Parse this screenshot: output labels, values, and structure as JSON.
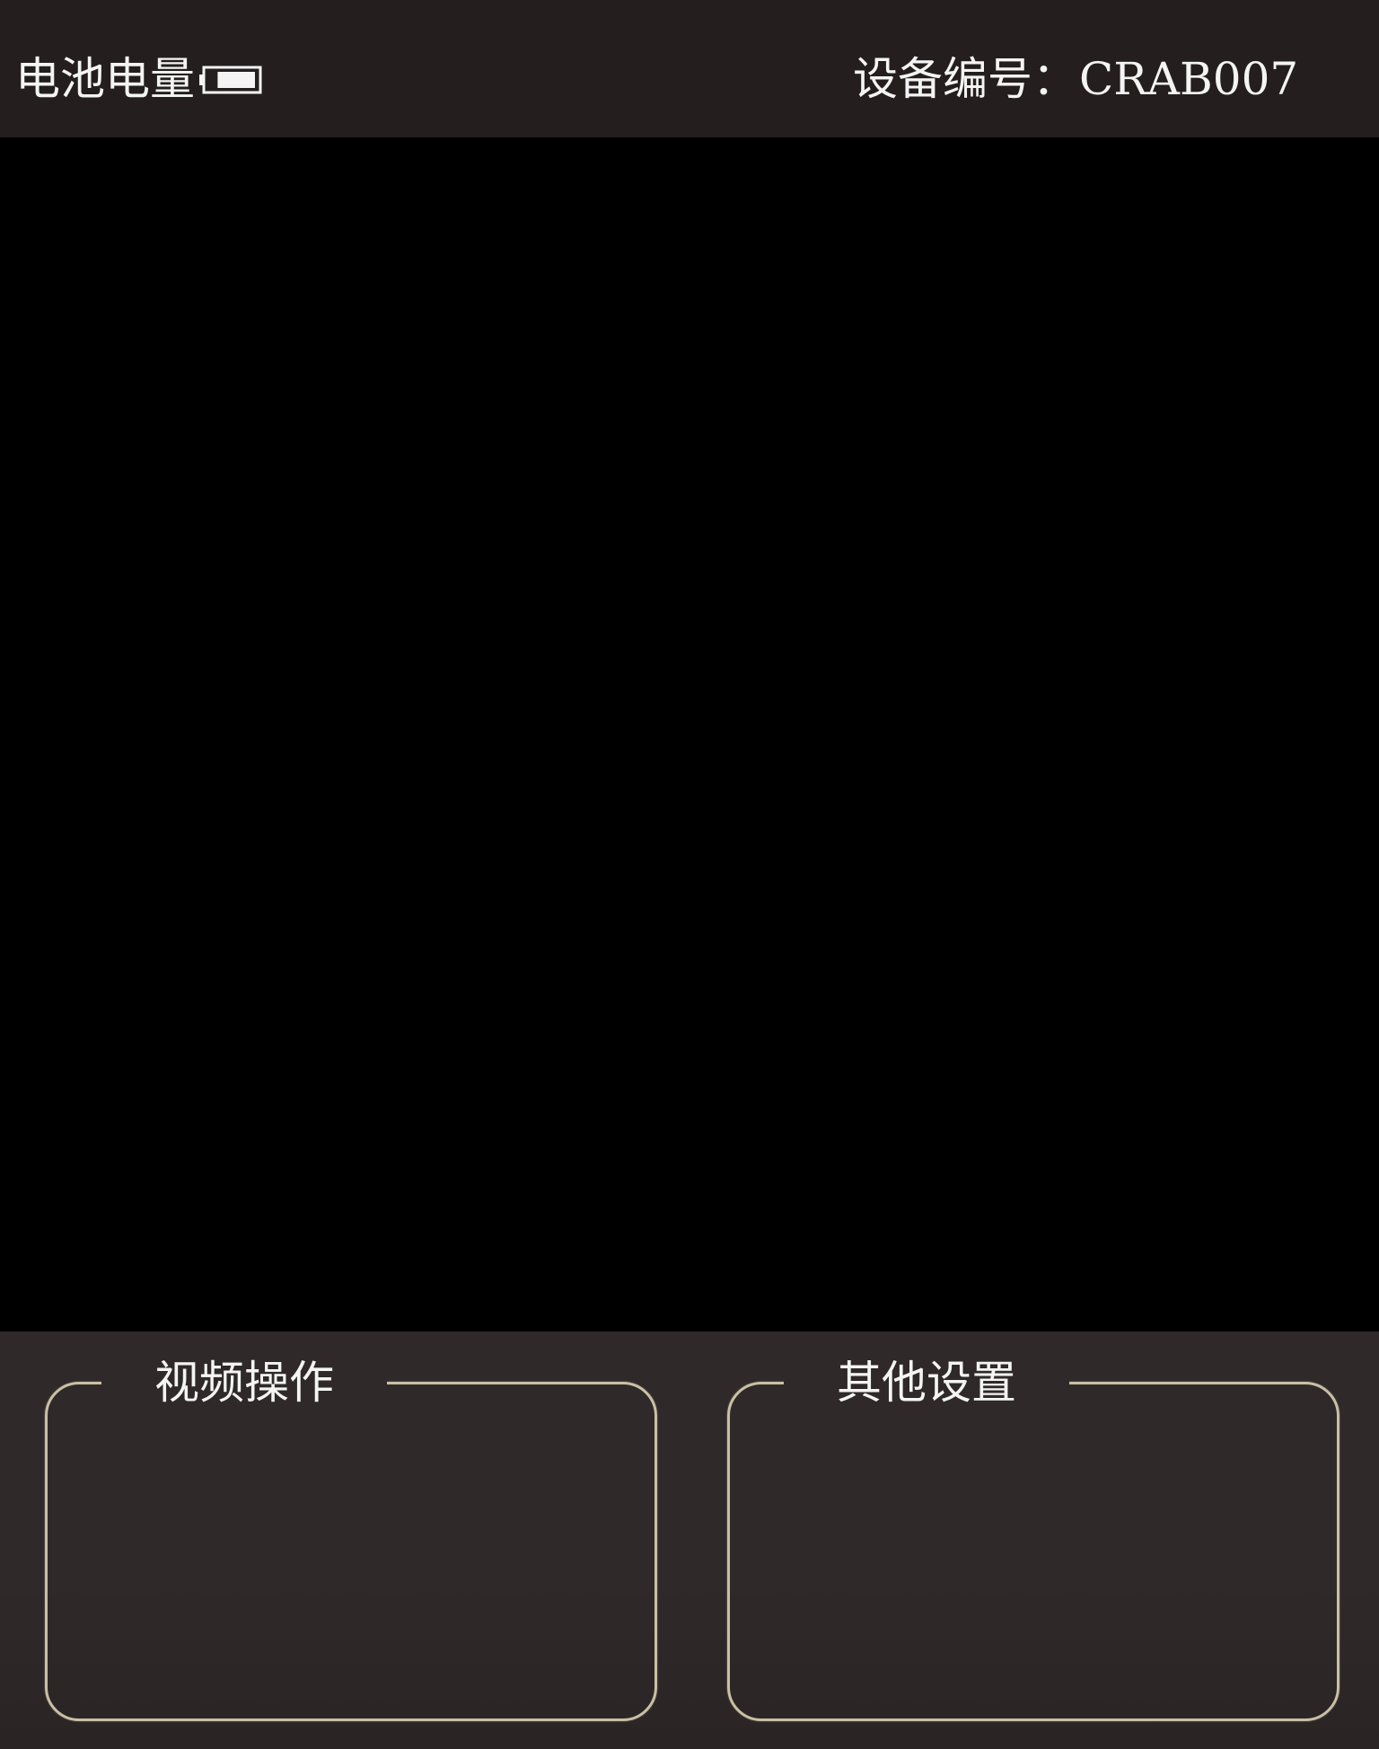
{
  "status_bar": {
    "battery_label": "电池电量",
    "battery_level": 0.8,
    "device_id_label": "设备编号",
    "device_id_separator": "：",
    "device_id_value": "CRAB007"
  },
  "video": {
    "state": "empty"
  },
  "panels": {
    "video_ops_title": "视频操作",
    "other_settings_title": "其他设置"
  },
  "colors": {
    "topbar_bg": "#241e1e",
    "video_bg": "#000000",
    "panel_bg": "#2f2929",
    "frame_border": "#c9c0a5",
    "text": "#f4f4f4"
  }
}
